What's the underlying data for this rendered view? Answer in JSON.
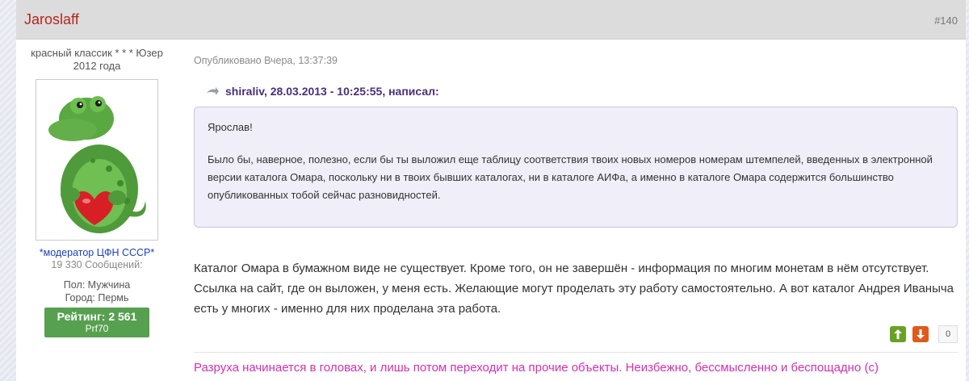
{
  "post": {
    "author": "Jaroslaff",
    "number": "#140",
    "author_title": "красный классик * * * Юзер 2012 года",
    "moderator_label": "*модератор ЦФН СССР*",
    "messages_count": "19 330 Сообщений:",
    "gender": "Пол: Мужчина",
    "city": "Город: Пермь",
    "rating_label": "Рейтинг: 2 561",
    "rating_sub": "Prf70",
    "published": "Опубликовано Вчера, 13:37:39",
    "quote_header": "shiraliv, 28.03.2013 - 10:25:55, написал:",
    "quote_p1": "Ярослав!",
    "quote_p2": "Было бы, наверное, полезно, если бы ты выложил еще таблицу соответствия твоих новых номеров номерам штемпелей, введенных в электронной версии каталога Омара, поскольку ни в твоих бывших каталогах, ни в каталоге АИФа, а именно в каталоге Омара  содержится большинство опубликованных тобой сейчас разновидностей.",
    "body": "Каталог Омара в бумажном виде не существует. Кроме того, он не завершён - информация по многим монетам в нём отсутствует. Ссылка на сайт, где он выложен, у меня есть. Желающие могут проделать эту работу самостоятельно. А вот каталог Андрея Иваныча есть у многих - именно для них проделана эта работа.",
    "vote_count": "0",
    "signature": "Разруха начинается в головах, и лишь потом переходит на прочие объекты. Неизбежно, бессмысленно и беспощадно (с)"
  },
  "icons": {
    "quote": "quote-arrow-icon",
    "vote_up": "arrow-up-icon",
    "vote_down": "arrow-down-icon"
  },
  "colors": {
    "author_name": "#b3261e",
    "rating_bg": "#56a04f",
    "quote_bg": "#f0eef9",
    "signature": "#d42fb1"
  }
}
